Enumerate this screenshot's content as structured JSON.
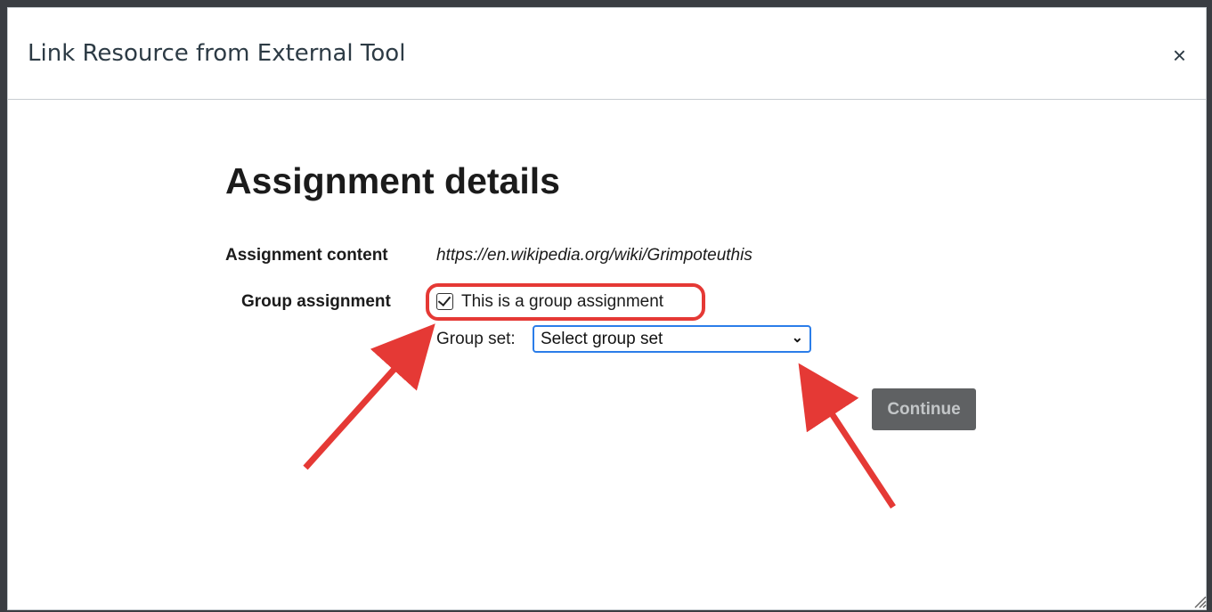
{
  "dialog": {
    "title": "Link Resource from External Tool",
    "close_symbol": "×",
    "close_icon": "close-icon"
  },
  "form": {
    "heading": "Assignment details",
    "content_label": "Assignment content",
    "content_url": "https://en.wikipedia.org/wiki/Grimpoteuthis",
    "group_label": "Group assignment",
    "checkbox_label": "This is a group assignment",
    "checkbox_checked": true,
    "group_set_label": "Group set:",
    "group_set_selected": "Select group set",
    "continue_label": "Continue"
  },
  "colors": {
    "annotation": "#e53935",
    "select_border": "#2b7de9",
    "button_bg": "#5f6163"
  }
}
